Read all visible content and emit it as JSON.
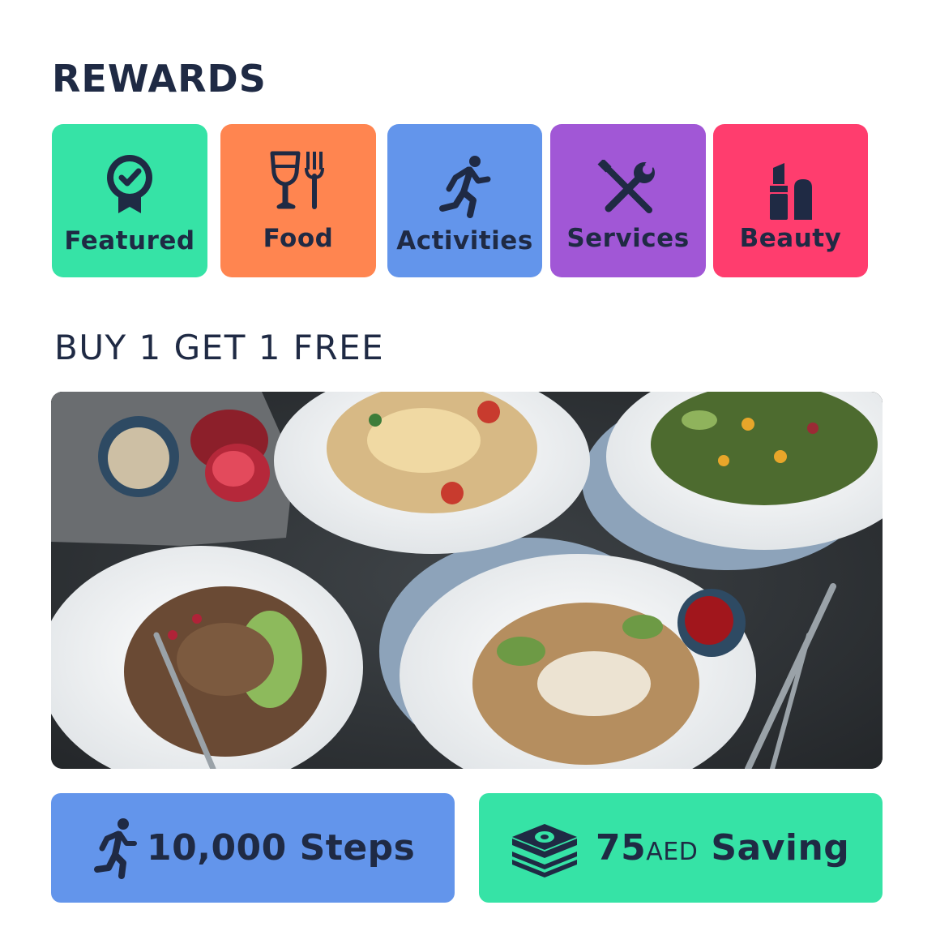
{
  "rewards": {
    "title": "REWARDS",
    "categories": [
      {
        "label": "Featured",
        "icon": "award-ribbon-icon",
        "color": "#36E3A6"
      },
      {
        "label": "Food",
        "icon": "cutlery-glass-icon",
        "color": "#FF8550"
      },
      {
        "label": "Activities",
        "icon": "running-person-icon",
        "color": "#6395EB"
      },
      {
        "label": "Services",
        "icon": "wrench-screwdriver-icon",
        "color": "#A157D6"
      },
      {
        "label": "Beauty",
        "icon": "lipstick-icon",
        "color": "#FF3D6E"
      }
    ]
  },
  "promo": {
    "title": "BUY 1 GET 1 FREE",
    "image": "salad-bowls-photo"
  },
  "stats": {
    "steps": {
      "value": "10,000 Steps",
      "icon": "running-person-icon",
      "color": "#6395EB"
    },
    "saving": {
      "amount": "75",
      "currency": "AED",
      "label": "Saving",
      "icon": "money-stack-icon",
      "color": "#36E3A6"
    }
  },
  "colors": {
    "text": "#1F2A44"
  }
}
